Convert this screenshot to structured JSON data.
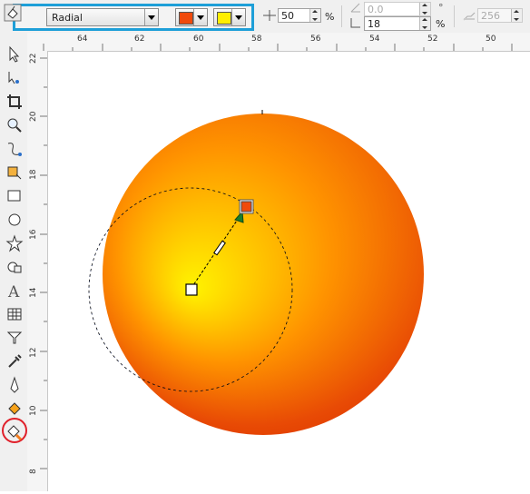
{
  "property_bar": {
    "fill_type": "Radial",
    "from_color": "#f04a0c",
    "to_color": "#ffee00",
    "edge_pad_value": "50",
    "edge_pad_unit": "%",
    "angle_value": "0.0",
    "angle_unit": "°",
    "center_offset_value": "18",
    "center_offset_unit": "%",
    "steps_value": "256"
  },
  "ruler": {
    "top_labels": [
      "64",
      "62",
      "60",
      "58",
      "56",
      "54",
      "52",
      "50"
    ],
    "left_labels": [
      "22",
      "20",
      "18",
      "16",
      "14",
      "12",
      "10",
      "8"
    ]
  },
  "toolbox": {
    "tools": [
      "pick-tool",
      "shape-tool",
      "crop-tool",
      "zoom-tool",
      "freehand-tool",
      "smart-fill-tool",
      "rectangle-tool",
      "ellipse-tool",
      "polygon-tool",
      "basic-shapes-tool",
      "text-tool",
      "table-tool",
      "dimension-tool",
      "eyedropper-tool",
      "outline-tool",
      "fill-tool",
      "interactive-fill-tool"
    ]
  },
  "gradient": {
    "outer_color": "#e84a05",
    "mid_color": "#ff9400",
    "inner_color": "#fff400"
  }
}
